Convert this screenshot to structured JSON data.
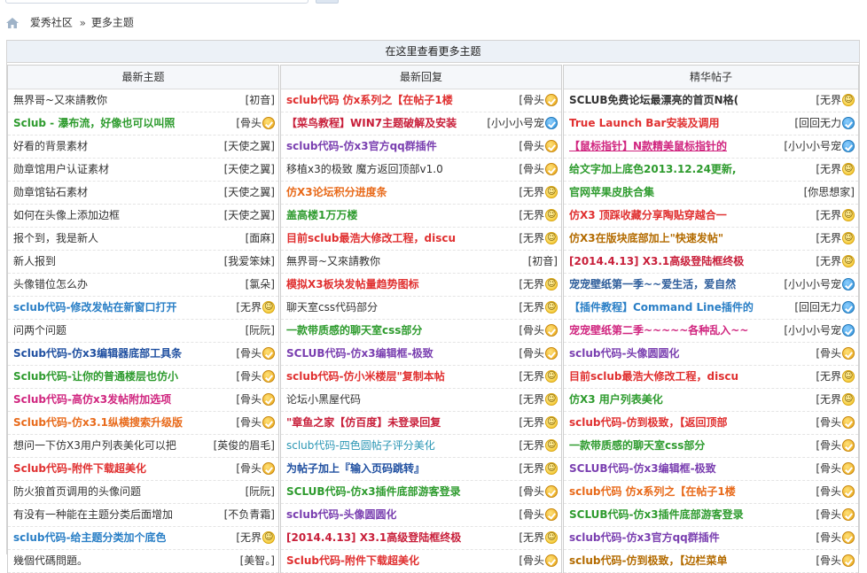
{
  "breadcrumb": {
    "site": "爱秀社区",
    "separator": "»",
    "current": "更多主题"
  },
  "panel_title": "在这里查看更多主题",
  "columns": [
    {
      "heading": "最新主题",
      "rows": [
        {
          "title": "無界哥~又來請教你",
          "author": "[初音]",
          "color": "black",
          "badge": ""
        },
        {
          "title": "Sclub - 瀑布流，好像也可以叫照",
          "author": "[骨头",
          "color": "green",
          "badge": "gold"
        },
        {
          "title": "好看的背景素材",
          "author": "[天使之翼]",
          "color": "black",
          "badge": ""
        },
        {
          "title": "勋章馆用户认证素材",
          "author": "[天使之翼]",
          "color": "black",
          "badge": ""
        },
        {
          "title": "勋章馆钻石素材",
          "author": "[天使之翼]",
          "color": "black",
          "badge": ""
        },
        {
          "title": "如何在头像上添加边框",
          "author": "[天使之翼]",
          "color": "black",
          "badge": ""
        },
        {
          "title": "报个到，我是新人",
          "author": "[面麻]",
          "color": "black",
          "badge": ""
        },
        {
          "title": "新人报到",
          "author": "[我爱笨妹]",
          "color": "black",
          "badge": ""
        },
        {
          "title": "头像错位怎么办",
          "author": "[氯朵]",
          "color": "black",
          "badge": ""
        },
        {
          "title": "sclub代码-修改发帖在新窗口打开",
          "author": "[无界",
          "color": "teal-b",
          "badge": "yel"
        },
        {
          "title": "问两个问题",
          "author": "[阮阮]",
          "color": "black",
          "badge": ""
        },
        {
          "title": "Sclub代码-仿x3编辑器底部工具条",
          "author": "[骨头",
          "color": "navy",
          "badge": "gold"
        },
        {
          "title": "Sclub代码-让你的普通楼层也仿小",
          "author": "[骨头",
          "color": "green",
          "badge": "gold"
        },
        {
          "title": "Sclub代码-高仿x3发帖附加选项",
          "author": "[骨头",
          "color": "magenta",
          "badge": "gold"
        },
        {
          "title": "Sclub代码-仿x3.1纵横搜索升级版",
          "author": "[骨头",
          "color": "orange",
          "badge": "gold"
        },
        {
          "title": "想问一下仿X3用户列表美化可以把",
          "author": "[英俊的眉毛]",
          "color": "black",
          "badge": ""
        },
        {
          "title": "Sclub代码-附件下载超美化",
          "author": "[骨头",
          "color": "red",
          "badge": "gold"
        },
        {
          "title": "防火狼首页调用的头像问题",
          "author": "[阮阮]",
          "color": "black",
          "badge": ""
        },
        {
          "title": "有没有一种能在主题分类后面增加",
          "author": "[不负青霜]",
          "color": "black",
          "badge": ""
        },
        {
          "title": "sclub代码-给主题分类加个底色",
          "author": "[无界",
          "color": "teal-b",
          "badge": "yel"
        },
        {
          "title": "幾個代碼問題。",
          "author": "[美智。]",
          "color": "black",
          "badge": ""
        }
      ]
    },
    {
      "heading": "最新回复",
      "rows": [
        {
          "title": "sclub代码 仿x系列之【在帖子1楼",
          "author": "[骨头",
          "color": "red",
          "badge": "gold"
        },
        {
          "title": "【菜鸟教程】WIN7主题破解及安装",
          "author": "[小小小号宠",
          "color": "crimson-n",
          "badge": "blue"
        },
        {
          "title": "sclub代码-仿x3官方qq群插件",
          "author": "[骨头",
          "color": "purple",
          "badge": "gold"
        },
        {
          "title": "移植x3的极致 魔方返回顶部v1.0",
          "author": "[骨头",
          "color": "black",
          "badge": "gold"
        },
        {
          "title": "仿X3论坛积分进度条",
          "author": "[无界",
          "color": "orange",
          "badge": "yel"
        },
        {
          "title": "盖高楼1万万楼",
          "author": "[无界",
          "color": "green",
          "badge": "yel"
        },
        {
          "title": "目前sclub最浩大修改工程，discu",
          "author": "[无界",
          "color": "red",
          "badge": "yel"
        },
        {
          "title": "無界哥~又來請教你",
          "author": "[初音]",
          "color": "black",
          "badge": ""
        },
        {
          "title": "模拟X3板块发帖量趋势图标",
          "author": "[无界",
          "color": "red",
          "badge": "yel"
        },
        {
          "title": "聊天室css代码部分",
          "author": "[无界",
          "color": "black",
          "badge": "yel"
        },
        {
          "title": "一款带质感的聊天室css部分",
          "author": "[骨头",
          "color": "green",
          "badge": "gold"
        },
        {
          "title": "SCLUB代码-仿x3编辑框-极致",
          "author": "[骨头",
          "color": "purple",
          "badge": "gold"
        },
        {
          "title": "sclub代码-仿小米楼层\"复制本帖",
          "author": "[无界",
          "color": "red",
          "badge": "yel"
        },
        {
          "title": "论坛小黑屋代码",
          "author": "[无界",
          "color": "black",
          "badge": "yel"
        },
        {
          "title": "\"章鱼之家【仿百度】未登录回复",
          "author": "[无界",
          "color": "crimson",
          "badge": "yel"
        },
        {
          "title": "sclub代码-四色圆帖子评分美化",
          "author": "[无界",
          "color": "teal",
          "badge": "yel"
        },
        {
          "title": "为帖子加上『输入页码跳转』",
          "author": "[无界",
          "color": "navy",
          "badge": "yel"
        },
        {
          "title": "SCLUB代码-仿x3插件底部游客登录",
          "author": "[骨头",
          "color": "green",
          "badge": "gold"
        },
        {
          "title": "sclub代码-头像圆圆化",
          "author": "[骨头",
          "color": "purple",
          "badge": "gold"
        },
        {
          "title": "[2014.4.13] X3.1高级登陆框终极",
          "author": "[无界",
          "color": "crimson",
          "badge": "yel"
        },
        {
          "title": "Sclub代码-附件下载超美化",
          "author": "[骨头",
          "color": "red",
          "badge": "gold"
        }
      ]
    },
    {
      "heading": "精华帖子",
      "rows": [
        {
          "title": "SCLUB免费论坛最漂亮的首页N格(",
          "author": "[无界",
          "color": "black-b",
          "badge": "yel"
        },
        {
          "title": "True Launch Bar安装及调用",
          "author": "[回回无力",
          "color": "red",
          "badge": "blue"
        },
        {
          "title": "【鼠标指针】N款精美鼠标指针的",
          "author": "[小小小号宠",
          "color": "magenta-u",
          "badge": "blue"
        },
        {
          "title": "给文字加上底色2013.12.24更新,",
          "author": "[无界",
          "color": "green",
          "badge": "yel"
        },
        {
          "title": "官网苹果皮肤合集",
          "author": "[你思想家]",
          "color": "green",
          "badge": ""
        },
        {
          "title": "仿X3 顶踩收藏分享陶贴穿越合一",
          "author": "[无界",
          "color": "red",
          "badge": "yel"
        },
        {
          "title": "仿X3在版块底部加上\"快速发帖\"",
          "author": "[无界",
          "color": "olive",
          "badge": "yel"
        },
        {
          "title": "[2014.4.13] X3.1高级登陆框终极",
          "author": "[无界",
          "color": "crimson",
          "badge": "yel"
        },
        {
          "title": "宠宠壁纸第一季~~爱生活，爱自然",
          "author": "[小小小号宠",
          "color": "dkblue",
          "badge": "blue"
        },
        {
          "title": "【插件教程】Command Line插件的",
          "author": "[回回无力",
          "color": "blue",
          "badge": "blue"
        },
        {
          "title": "宠宠壁纸第二季~~~~~各种乱入~~",
          "author": "[小小小号宠",
          "color": "magenta",
          "badge": "blue"
        },
        {
          "title": "sclub代码-头像圆圆化",
          "author": "[骨头",
          "color": "purple",
          "badge": "gold"
        },
        {
          "title": "目前sclub最浩大修改工程，discu",
          "author": "[无界",
          "color": "red",
          "badge": "yel"
        },
        {
          "title": "仿X3 用户列表美化",
          "author": "[无界",
          "color": "green",
          "badge": "yel"
        },
        {
          "title": "sclub代码-仿到极致，【返回顶部",
          "author": "[骨头",
          "color": "red",
          "badge": "gold"
        },
        {
          "title": "一款带质感的聊天室css部分",
          "author": "[骨头",
          "color": "green",
          "badge": "gold"
        },
        {
          "title": "SCLUB代码-仿x3编辑框-极致",
          "author": "[骨头",
          "color": "purple",
          "badge": "gold"
        },
        {
          "title": "sclub代码 仿x系列之【在帖子1楼",
          "author": "[骨头",
          "color": "orange",
          "badge": "gold"
        },
        {
          "title": "SCLUB代码-仿x3插件底部游客登录",
          "author": "[骨头",
          "color": "green",
          "badge": "gold"
        },
        {
          "title": "sclub代码-仿x3官方qq群插件",
          "author": "[骨头",
          "color": "purple",
          "badge": "gold"
        },
        {
          "title": "sclub代码-仿到极致，【边栏菜单",
          "author": "[骨头",
          "color": "olive",
          "badge": "gold"
        }
      ]
    }
  ]
}
